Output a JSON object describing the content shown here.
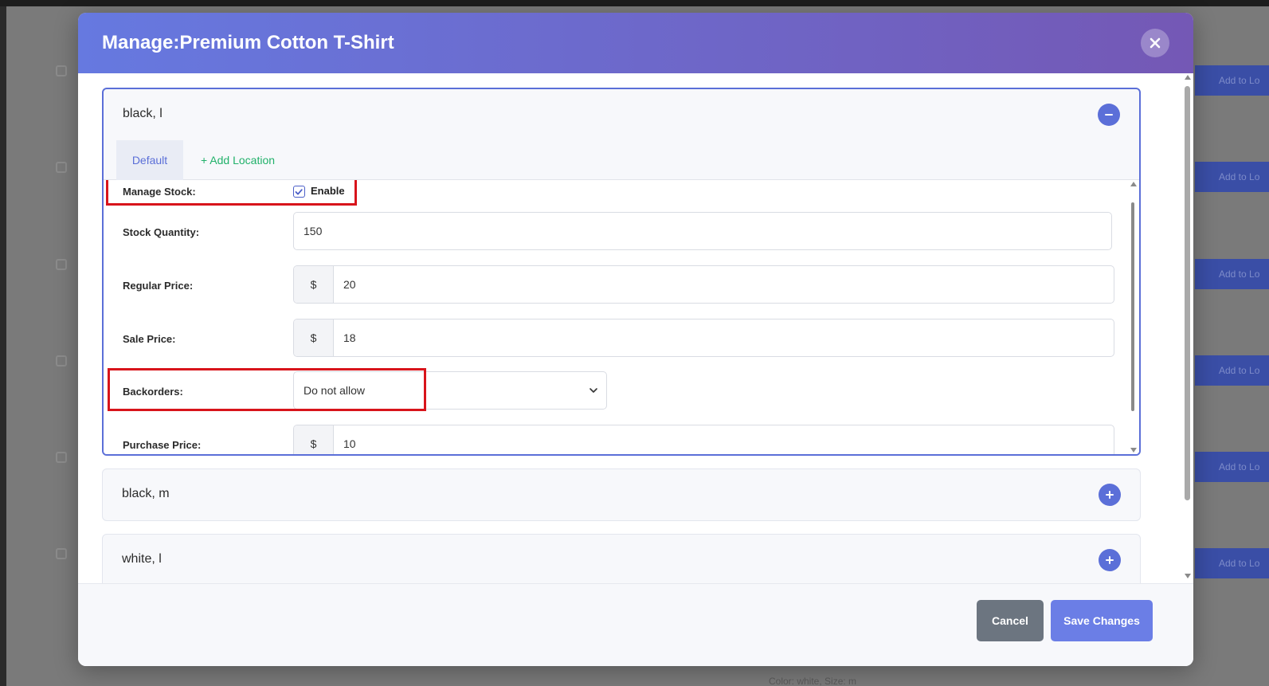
{
  "modal": {
    "title": "Manage:Premium Cotton T-Shirt"
  },
  "variations": [
    {
      "name": "black, l",
      "expanded": true,
      "tabs": {
        "default_label": "Default",
        "add_location_label": "+ Add Location"
      },
      "fields": {
        "manage_stock_label": "Manage Stock:",
        "manage_stock_enabled": true,
        "enable_label": "Enable",
        "stock_quantity_label": "Stock Quantity:",
        "stock_quantity": "150",
        "regular_price_label": "Regular Price:",
        "regular_price_currency": "$",
        "regular_price": "20",
        "sale_price_label": "Sale Price:",
        "sale_price_currency": "$",
        "sale_price": "18",
        "backorders_label": "Backorders:",
        "backorders_value": "Do not allow",
        "purchase_price_label": "Purchase Price:",
        "purchase_price_currency": "$",
        "purchase_price": "10"
      }
    },
    {
      "name": "black, m",
      "expanded": false
    },
    {
      "name": "white, l",
      "expanded": false
    }
  ],
  "footer": {
    "cancel_label": "Cancel",
    "save_label": "Save Changes"
  },
  "background": {
    "row_button_label": "Add to Lo",
    "footer_text": "Color: white, Size: m"
  },
  "colors": {
    "header_gradient_start": "#6679e0",
    "header_gradient_end": "#7458b5",
    "accent": "#5b6fd8",
    "add_location": "#21b16a",
    "highlight": "#d8141b",
    "cancel_button": "#6c7580",
    "save_button": "#6b7ee6"
  }
}
